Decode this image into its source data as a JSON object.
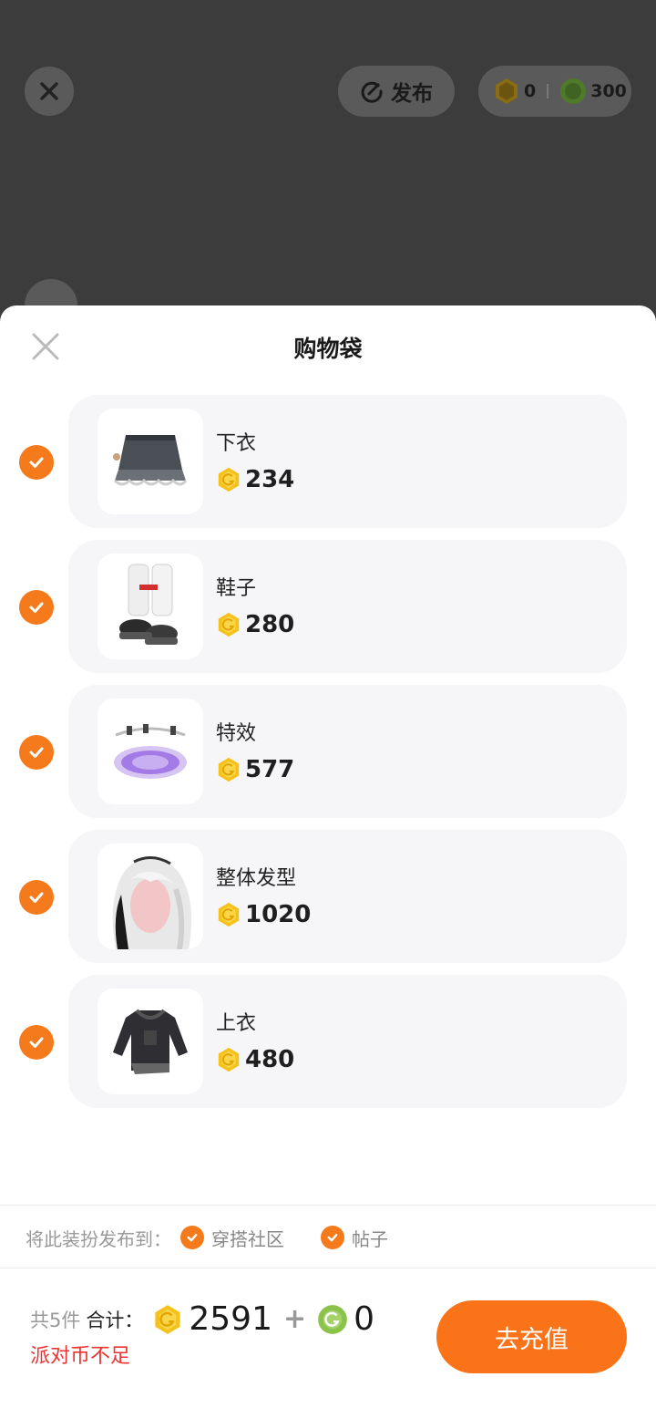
{
  "header": {
    "publish_label": "发布",
    "gold_balance": "0",
    "green_balance": "300"
  },
  "sheet": {
    "title": "购物袋"
  },
  "items": [
    {
      "name": "下衣",
      "price": "234"
    },
    {
      "name": "鞋子",
      "price": "280"
    },
    {
      "name": "特效",
      "price": "577"
    },
    {
      "name": "整体发型",
      "price": "1020"
    },
    {
      "name": "上衣",
      "price": "480"
    }
  ],
  "publish_to": {
    "label": "将此装扮发布到：",
    "options": [
      "穿搭社区",
      "帖子"
    ]
  },
  "footer": {
    "count_text": "共5件",
    "total_label": "合计：",
    "gold_total": "2591",
    "plus": "+",
    "green_total": "0",
    "warning": "派对币不足",
    "recharge_label": "去充值"
  },
  "colors": {
    "accent": "#f47a1b",
    "gold_coin": "#f5c21b",
    "green_coin": "#8bc34a",
    "warning": "#e33333"
  }
}
